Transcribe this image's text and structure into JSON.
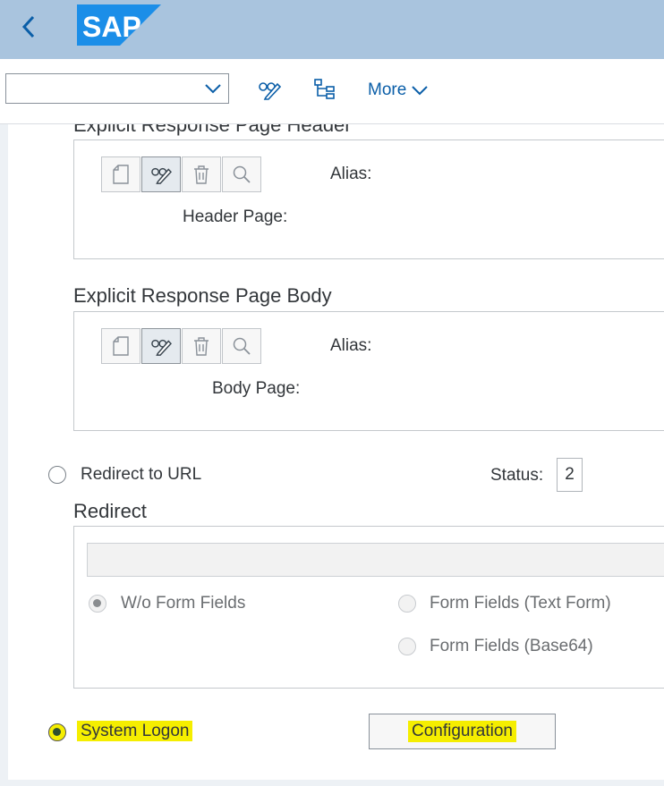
{
  "shell": {
    "logo_text": "SAP",
    "brand_color": "#1b8ee8"
  },
  "toolbar": {
    "dropdown_value": "",
    "more_label": "More"
  },
  "explicit_header": {
    "title": "Explicit Response Page Header",
    "alias_label": "Alias:",
    "page_label": "Header Page:"
  },
  "explicit_body": {
    "title": "Explicit Response Page Body",
    "alias_label": "Alias:",
    "page_label": "Body Page:"
  },
  "redirect_option": {
    "label": "Redirect to URL",
    "status_label": "Status:",
    "status_value": "2"
  },
  "redirect": {
    "title": "Redirect",
    "url_value": "",
    "options": [
      "W/o Form Fields",
      "Form Fields (Text Form)",
      "Form Fields (Base64)"
    ],
    "selected_option": "W/o Form Fields"
  },
  "system_logon": {
    "label": "System Logon",
    "selected": true,
    "config_label": "Configuration",
    "highlight_color": "#f5ee00"
  },
  "icons": [
    "back-icon",
    "edit-glasses-icon",
    "hierarchy-icon",
    "chevron-down-icon",
    "new-document-icon",
    "trash-icon",
    "search-icon"
  ]
}
